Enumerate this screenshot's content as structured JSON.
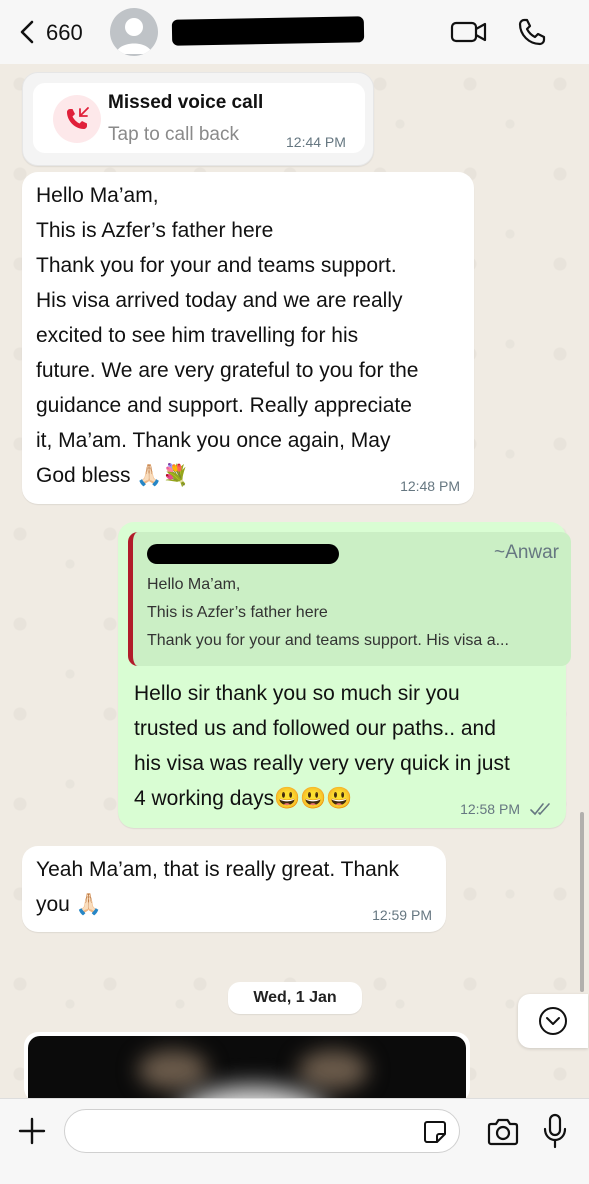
{
  "header": {
    "unread_count": "660"
  },
  "missed_call": {
    "title": "Missed voice call",
    "subtitle": "Tap to call back",
    "time": "12:44 PM"
  },
  "messages": [
    {
      "direction": "incoming",
      "text": "Hello Ma’am,\nThis is Azfer’s father here\nThank you for your and teams support.\nHis visa arrived today and we are really\nexcited to see him travelling for his\nfuture. We are very grateful to you for the\nguidance and support. Really appreciate\nit, Ma’am. Thank you once again, May\nGod bless 🙏🏻💐",
      "time": "12:48 PM"
    },
    {
      "direction": "outgoing",
      "quote": {
        "author": "~Anwar",
        "lines": [
          "Hello Ma’am,",
          "This is Azfer’s father here",
          "Thank you for your and teams support. His visa a..."
        ]
      },
      "text": "Hello sir thank you so much sir you\ntrusted us and followed our paths.. and\nhis visa was really very very quick in just\n4 working days😃😃😃",
      "time": "12:58 PM"
    },
    {
      "direction": "incoming",
      "text": "Yeah Ma’am, that is really great. Thank\nyou 🙏🏻",
      "time": "12:59 PM"
    }
  ],
  "date_separator": "Wed, 1 Jan",
  "colors": {
    "incoming_bubble": "#ffffff",
    "outgoing_bubble": "#d9fdd3",
    "quote_bar": "#b11c2a",
    "missed_call_accent": "#e0203a",
    "read_ticks": "#667781"
  },
  "icons": [
    "back-chevron-icon",
    "video-call-icon",
    "phone-icon",
    "missed-call-icon",
    "chevron-down-icon",
    "plus-icon",
    "sticker-icon",
    "camera-icon",
    "microphone-icon",
    "double-tick-icon"
  ]
}
